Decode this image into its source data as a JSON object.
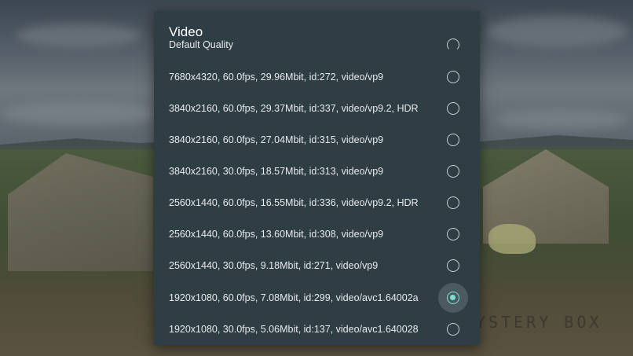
{
  "background": {
    "watermark": "YSTERY BOX"
  },
  "dialog": {
    "title": "Video",
    "options": [
      {
        "label": "Default Quality",
        "selected": false
      },
      {
        "label": "7680x4320, 60.0fps, 29.96Mbit, id:272, video/vp9",
        "selected": false
      },
      {
        "label": "3840x2160, 60.0fps, 29.37Mbit, id:337, video/vp9.2, HDR",
        "selected": false
      },
      {
        "label": "3840x2160, 60.0fps, 27.04Mbit, id:315, video/vp9",
        "selected": false
      },
      {
        "label": "3840x2160, 30.0fps, 18.57Mbit, id:313, video/vp9",
        "selected": false
      },
      {
        "label": "2560x1440, 60.0fps, 16.55Mbit, id:336, video/vp9.2, HDR",
        "selected": false
      },
      {
        "label": "2560x1440, 60.0fps, 13.60Mbit, id:308, video/vp9",
        "selected": false
      },
      {
        "label": "2560x1440, 30.0fps, 9.18Mbit, id:271, video/vp9",
        "selected": false
      },
      {
        "label": "1920x1080, 60.0fps, 7.08Mbit, id:299, video/avc1.64002a",
        "selected": true
      },
      {
        "label": "1920x1080, 30.0fps, 5.06Mbit, id:137, video/avc1.640028",
        "selected": false
      }
    ]
  },
  "colors": {
    "dialog_bg": "#2f3e45",
    "accent": "#7fe0d2",
    "text": "#e6eaec"
  }
}
